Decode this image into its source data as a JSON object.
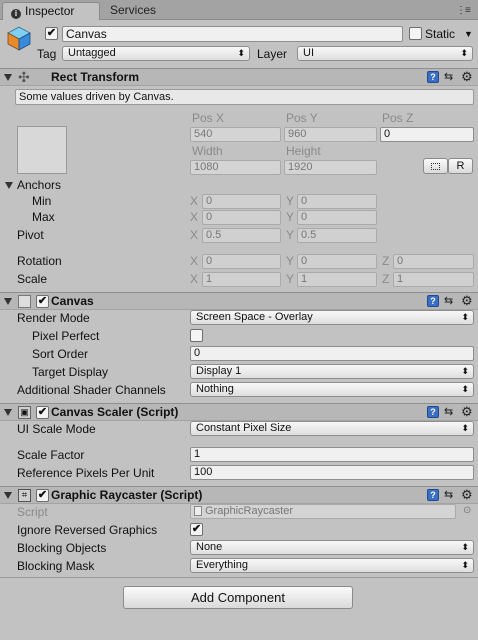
{
  "tabs": {
    "inspector": "Inspector",
    "services": "Services"
  },
  "gameobject": {
    "name": "Canvas",
    "active": true,
    "static_label": "Static",
    "tag_label": "Tag",
    "tag_value": "Untagged",
    "layer_label": "Layer",
    "layer_value": "UI"
  },
  "rect_transform": {
    "title": "Rect Transform",
    "info": "Some values driven by Canvas.",
    "pos_x_label": "Pos X",
    "pos_x": "540",
    "pos_y_label": "Pos Y",
    "pos_y": "960",
    "pos_z_label": "Pos Z",
    "pos_z": "0",
    "width_label": "Width",
    "width": "1080",
    "height_label": "Height",
    "height": "1920",
    "r_button": "R",
    "anchors_label": "Anchors",
    "min_label": "Min",
    "min_x": "0",
    "min_y": "0",
    "max_label": "Max",
    "max_x": "0",
    "max_y": "0",
    "pivot_label": "Pivot",
    "pivot_x": "0.5",
    "pivot_y": "0.5",
    "rotation_label": "Rotation",
    "rot_x": "0",
    "rot_y": "0",
    "rot_z": "0",
    "scale_label": "Scale",
    "scale_x": "1",
    "scale_y": "1",
    "scale_z": "1",
    "x": "X",
    "y": "Y",
    "z": "Z"
  },
  "canvas": {
    "title": "Canvas",
    "render_mode_label": "Render Mode",
    "render_mode": "Screen Space - Overlay",
    "pixel_perfect_label": "Pixel Perfect",
    "sort_order_label": "Sort Order",
    "sort_order": "0",
    "target_display_label": "Target Display",
    "target_display": "Display 1",
    "shader_channels_label": "Additional Shader Channels",
    "shader_channels": "Nothing"
  },
  "canvas_scaler": {
    "title": "Canvas Scaler (Script)",
    "ui_scale_mode_label": "UI Scale Mode",
    "ui_scale_mode": "Constant Pixel Size",
    "scale_factor_label": "Scale Factor",
    "scale_factor": "1",
    "ref_ppu_label": "Reference Pixels Per Unit",
    "ref_ppu": "100"
  },
  "graphic_raycaster": {
    "title": "Graphic Raycaster (Script)",
    "script_label": "Script",
    "script_value": "GraphicRaycaster",
    "ignore_reversed_label": "Ignore Reversed Graphics",
    "ignore_reversed": true,
    "blocking_objects_label": "Blocking Objects",
    "blocking_objects": "None",
    "blocking_mask_label": "Blocking Mask",
    "blocking_mask": "Everything"
  },
  "add_component": "Add Component",
  "icons": [
    "info-icon",
    "menu-icon",
    "cube-icon",
    "rect-transform-icon",
    "canvas-icon",
    "script-icon",
    "help-icon",
    "preset-icon",
    "gear-icon",
    "blueprint-icon"
  ],
  "colors": {
    "background": "#c2c2c2",
    "header": "#b7b7b7",
    "help_blue": "#3b6fc4"
  }
}
